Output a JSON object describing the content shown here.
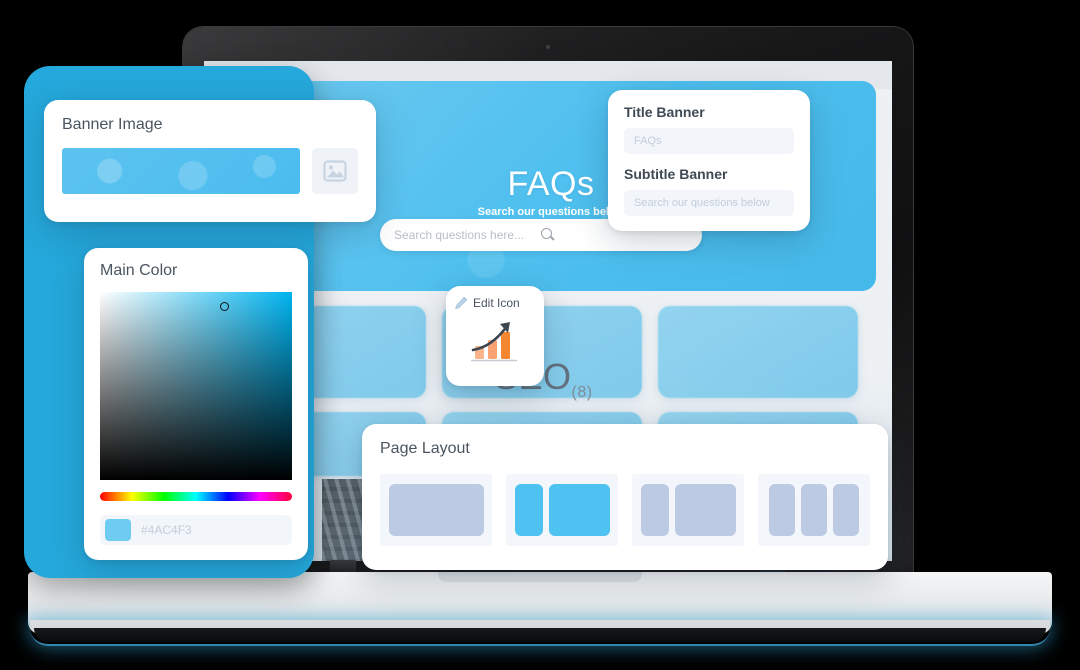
{
  "screen": {
    "hero": {
      "title": "FAQs",
      "subtitle": "Search our questions below",
      "search_placeholder": "Search questions here..."
    },
    "category": {
      "label": "SEO",
      "count": "(8)"
    }
  },
  "panels": {
    "banner_image": {
      "title": "Banner Image",
      "image_button_icon": "image-placeholder-icon"
    },
    "title_banner": {
      "title_label": "Title Banner",
      "title_value": "FAQs",
      "subtitle_label": "Subtitle Banner",
      "subtitle_value": "Search our questions below"
    },
    "main_color": {
      "title": "Main Color",
      "hex": "#4AC4F3",
      "swatch_color": "#6ECBF2",
      "selected_color": "#4AC4F3"
    },
    "edit_icon": {
      "title": "Edit Icon",
      "pencil_icon": "pencil-icon",
      "preview_icon": "growth-chart-icon"
    },
    "page_layout": {
      "title": "Page Layout",
      "options": [
        {
          "name": "full-width",
          "selected": false
        },
        {
          "name": "sidebar-left-main-right",
          "selected": true
        },
        {
          "name": "two-column",
          "selected": false
        },
        {
          "name": "three-column",
          "selected": false
        }
      ]
    }
  },
  "colors": {
    "accent": "#4AC4F3",
    "ribbon": "#25A8DB",
    "panel_bg": "#FFFFFF",
    "field_bg": "#F2F6FA",
    "block_gray": "#BCCBE3"
  }
}
